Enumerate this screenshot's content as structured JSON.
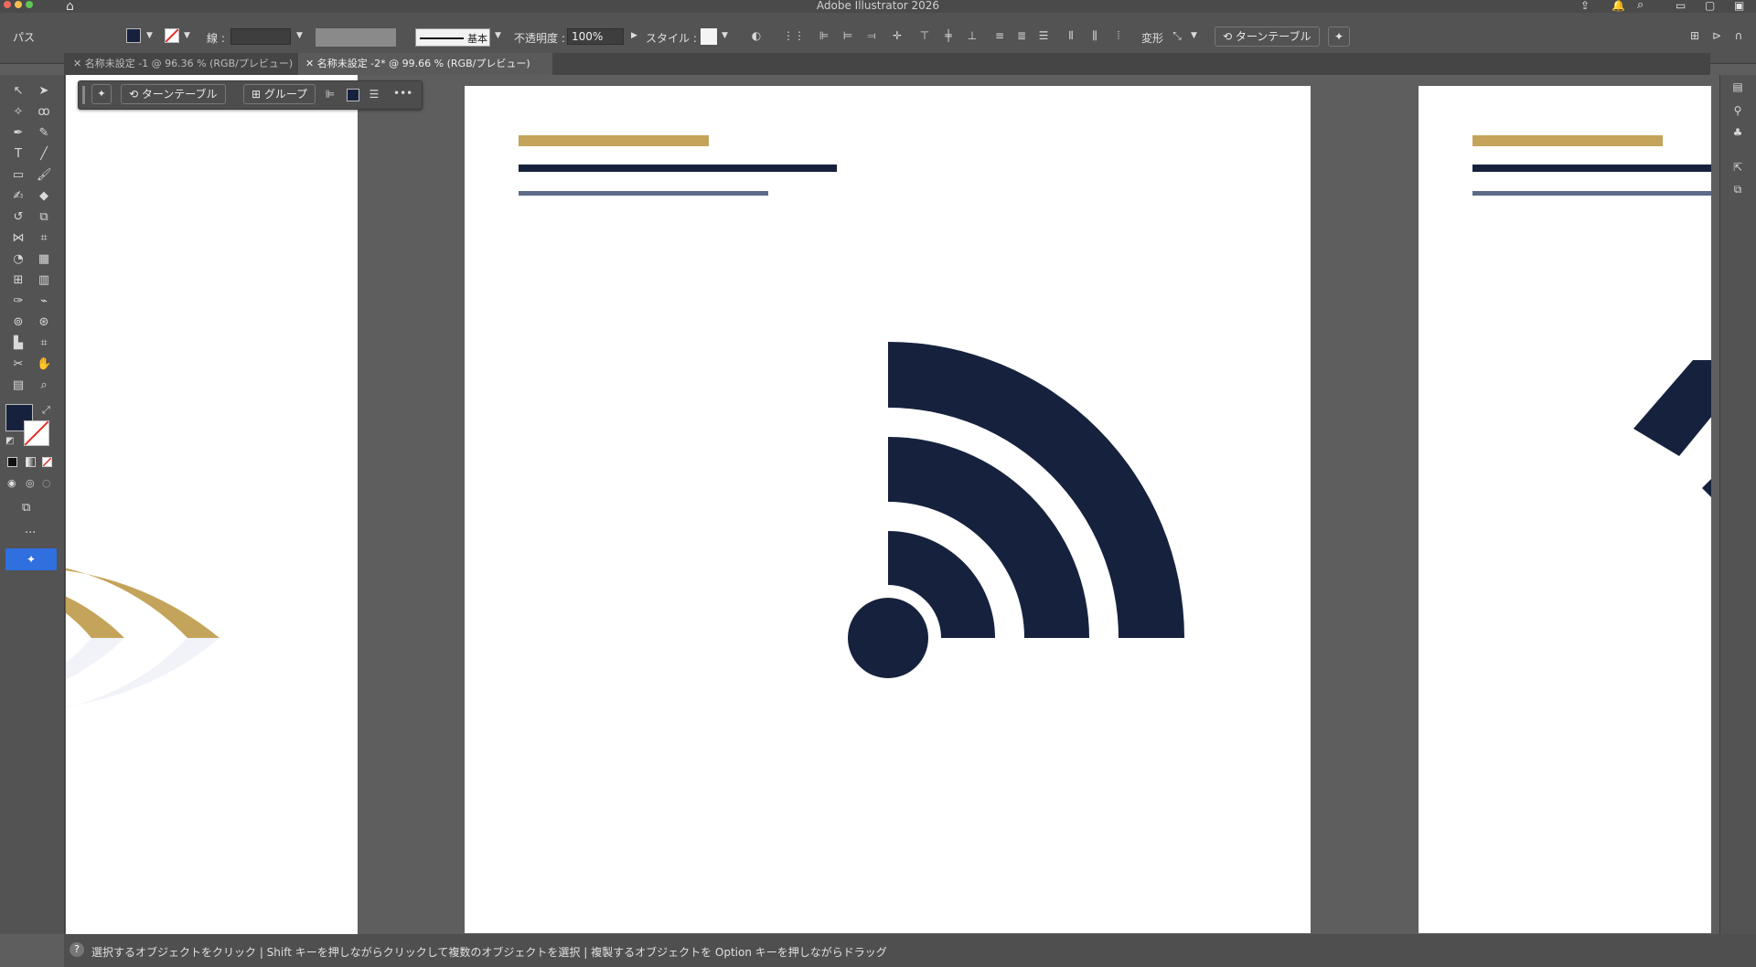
{
  "window": {
    "title": "Adobe Illustrator 2026"
  },
  "control_bar": {
    "selection_label": "パス",
    "fill_color": "#16223d",
    "stroke_label": "線 :",
    "brush_label": "基本",
    "opacity_label": "不透明度 :",
    "opacity_value": "100%",
    "style_label": "スタイル :",
    "transform_label": "変形",
    "turntable_label": "ターンテーブル"
  },
  "tabs": [
    {
      "label": "名称未設定 -1 @ 96.36 % (RGB/プレビュー)",
      "active": false
    },
    {
      "label": "名称未設定 -2* @ 99.66 % (RGB/プレビュー)",
      "active": true
    }
  ],
  "context_bar": {
    "turntable_label": "ターンテーブル",
    "group_label": "グループ"
  },
  "status_bar": {
    "hint": "選択するオブジェクトをクリック  |  Shift キーを押しながらクリックして複数のオブジェクトを選択  |  複製するオブジェクトを Option キーを押しながらドラッグ"
  },
  "colors": {
    "navy": "#16223d",
    "gold": "#c4a45a",
    "slate": "#5c6b87",
    "pale": "#f1f3f8",
    "accent_blue": "#2f6fe0"
  },
  "icons": {
    "home": "home-icon",
    "share": "share-icon",
    "search": "search-icon",
    "notifications": "bell-icon"
  }
}
